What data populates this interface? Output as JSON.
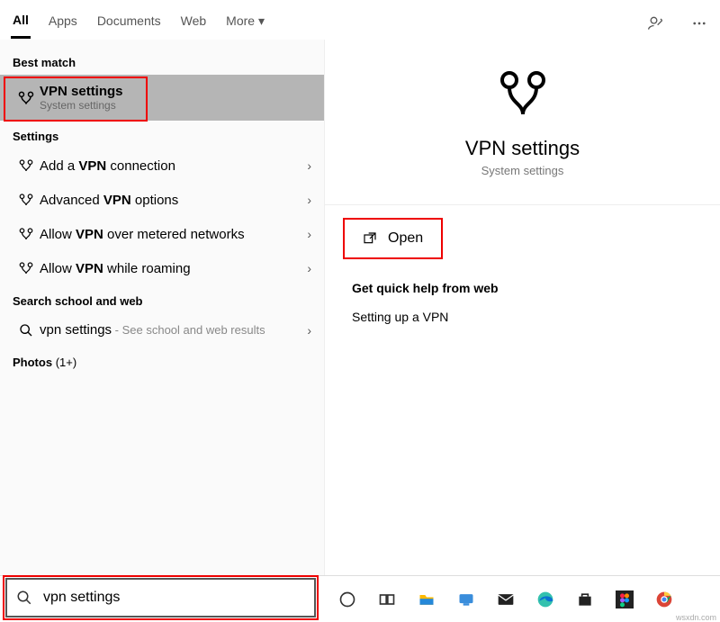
{
  "tabs": {
    "all": "All",
    "apps": "Apps",
    "documents": "Documents",
    "web": "Web",
    "more": "More"
  },
  "groups": {
    "best_match": "Best match",
    "settings": "Settings",
    "search_web": "Search school and web",
    "photos_prefix": "Photos",
    "photos_count": "(1+)"
  },
  "best_match": {
    "title": "VPN settings",
    "sub": "System settings"
  },
  "settings_items": [
    {
      "pre": "Add a ",
      "bold": "VPN",
      "post": " connection"
    },
    {
      "pre": "Advanced ",
      "bold": "VPN",
      "post": " options"
    },
    {
      "pre": "Allow ",
      "bold": "VPN",
      "post": " over metered networks"
    },
    {
      "pre": "Allow ",
      "bold": "VPN",
      "post": " while roaming"
    }
  ],
  "web_item": {
    "title": "vpn settings",
    "suffix": " - See school and web results"
  },
  "preview": {
    "title": "VPN settings",
    "sub": "System settings",
    "open": "Open",
    "quick_title": "Get quick help from web",
    "quick_item": "Setting up a VPN"
  },
  "search_value": "vpn settings",
  "watermark": "wsxdn.com"
}
